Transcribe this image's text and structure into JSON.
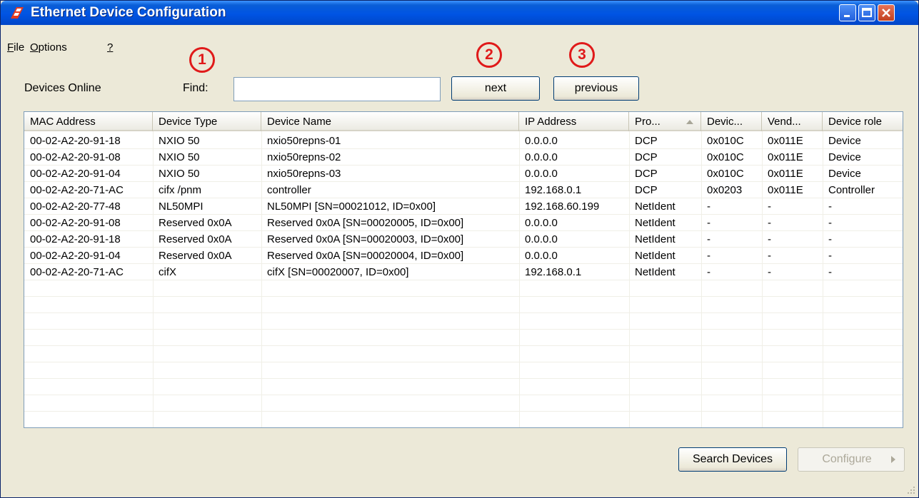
{
  "window": {
    "title": "Ethernet Device Configuration"
  },
  "menu": [
    "File",
    "Options",
    "?"
  ],
  "toolbar": {
    "devices_online_label": "Devices Online",
    "find_label": "Find:",
    "find_value": "",
    "next_label": "next",
    "previous_label": "previous"
  },
  "callouts": [
    "1",
    "2",
    "3"
  ],
  "table": {
    "columns": [
      "MAC Address",
      "Device Type",
      "Device Name",
      "IP Address",
      "Pro...",
      "Devic...",
      "Vend...",
      "Device role"
    ],
    "sorted_column": "Pro...",
    "rows": [
      [
        "00-02-A2-20-91-18",
        "NXIO 50",
        "nxio50repns-01",
        "0.0.0.0",
        "DCP",
        "0x010C",
        "0x011E",
        "Device"
      ],
      [
        "00-02-A2-20-91-08",
        "NXIO 50",
        "nxio50repns-02",
        "0.0.0.0",
        "DCP",
        "0x010C",
        "0x011E",
        "Device"
      ],
      [
        "00-02-A2-20-91-04",
        "NXIO 50",
        "nxio50repns-03",
        "0.0.0.0",
        "DCP",
        "0x010C",
        "0x011E",
        "Device"
      ],
      [
        "00-02-A2-20-71-AC",
        "cifx /pnm",
        "controller",
        "192.168.0.1",
        "DCP",
        "0x0203",
        "0x011E",
        "Controller"
      ],
      [
        "00-02-A2-20-77-48",
        "NL50MPI",
        "NL50MPI [SN=00021012, ID=0x00]",
        "192.168.60.199",
        "NetIdent",
        "-",
        "-",
        "-"
      ],
      [
        "00-02-A2-20-91-08",
        "Reserved 0x0A",
        "Reserved 0x0A [SN=00020005, ID=0x00]",
        "0.0.0.0",
        "NetIdent",
        "-",
        "-",
        "-"
      ],
      [
        "00-02-A2-20-91-18",
        "Reserved 0x0A",
        "Reserved 0x0A [SN=00020003, ID=0x00]",
        "0.0.0.0",
        "NetIdent",
        "-",
        "-",
        "-"
      ],
      [
        "00-02-A2-20-91-04",
        "Reserved 0x0A",
        "Reserved 0x0A [SN=00020004, ID=0x00]",
        "0.0.0.0",
        "NetIdent",
        "-",
        "-",
        "-"
      ],
      [
        "00-02-A2-20-71-AC",
        "cifX",
        "cifX [SN=00020007, ID=0x00]",
        "192.168.0.1",
        "NetIdent",
        "-",
        "-",
        "-"
      ]
    ]
  },
  "footer": {
    "search_label": "Search Devices",
    "configure_label": "Configure"
  },
  "colors": {
    "titlebar": "#0054e3",
    "window_bg": "#ece9d8",
    "callout_red": "#e01a1a"
  }
}
